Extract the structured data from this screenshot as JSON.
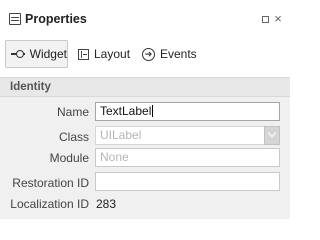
{
  "panel": {
    "title": "Properties",
    "title_icon": "properties-icon",
    "window_buttons": [
      "maximize-icon",
      "close-icon"
    ],
    "close_glyph": "×"
  },
  "tabs": [
    {
      "label": "Widget",
      "icon": "widget-icon",
      "active": true
    },
    {
      "label": "Layout",
      "icon": "layout-icon",
      "active": false
    },
    {
      "label": "Events",
      "icon": "events-icon",
      "active": false
    }
  ],
  "section": {
    "title": "Identity"
  },
  "properties": {
    "name": {
      "label": "Name",
      "value": "TextLabel"
    },
    "class": {
      "label": "Class",
      "placeholder": "UILabel"
    },
    "module": {
      "label": "Module",
      "placeholder": "None"
    },
    "restoration_id": {
      "label": "Restoration ID",
      "value": ""
    },
    "localization_id": {
      "label": "Localization ID",
      "value": "283"
    }
  },
  "colors": {
    "section_bg": "#e8e8e8",
    "panel_bg": "#f0f0f0",
    "placeholder": "#b5b5b5"
  }
}
